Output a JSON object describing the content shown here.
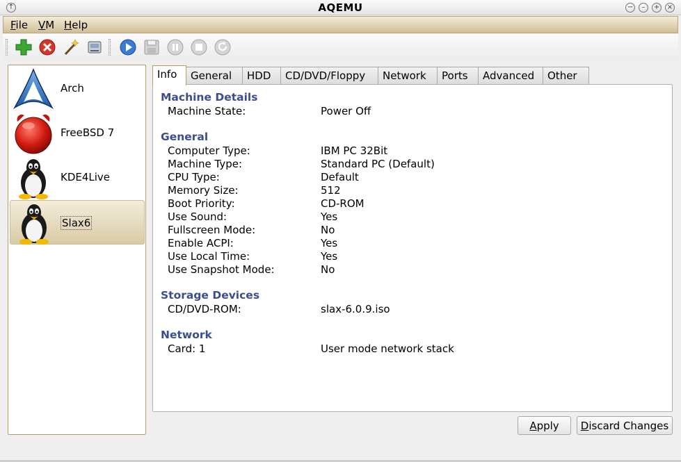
{
  "window": {
    "title": "AQEMU"
  },
  "menu": [
    {
      "mnemonic": "F",
      "rest": "ile"
    },
    {
      "mnemonic": "V",
      "rest": "M"
    },
    {
      "mnemonic": "H",
      "rest": "elp"
    }
  ],
  "toolbar": {
    "icons": [
      "add-vm-icon",
      "delete-vm-icon",
      "wizard-icon",
      "manager-icon",
      "start-icon",
      "save-icon",
      "pause-icon",
      "stop-icon",
      "reset-icon"
    ]
  },
  "vm_list": [
    {
      "name": "Arch",
      "icon": "arch-logo-icon"
    },
    {
      "name": "FreeBSD 7",
      "icon": "freebsd-logo-icon"
    },
    {
      "name": "KDE4Live",
      "icon": "tux-icon"
    },
    {
      "name": "Slax6",
      "icon": "tux-icon",
      "selected": true
    }
  ],
  "tabs": [
    "Info",
    "General",
    "HDD",
    "CD/DVD/Floppy",
    "Network",
    "Ports",
    "Advanced",
    "Other"
  ],
  "active_tab": "Info",
  "info": {
    "machine_details": {
      "title": "Machine Details",
      "rows": [
        {
          "label": "Machine State:",
          "value": "Power Off"
        }
      ]
    },
    "general": {
      "title": "General",
      "rows": [
        {
          "label": "Computer Type:",
          "value": "IBM PC 32Bit"
        },
        {
          "label": "Machine Type:",
          "value": "Standard PC (Default)"
        },
        {
          "label": "CPU Type:",
          "value": "Default"
        },
        {
          "label": "Memory Size:",
          "value": "512"
        },
        {
          "label": "Boot Priority:",
          "value": "CD-ROM"
        },
        {
          "label": "Use Sound:",
          "value": "Yes"
        },
        {
          "label": "Fullscreen Mode:",
          "value": "No"
        },
        {
          "label": "Enable ACPI:",
          "value": "Yes"
        },
        {
          "label": "Use Local Time:",
          "value": "Yes"
        },
        {
          "label": "Use Snapshot Mode:",
          "value": "No"
        }
      ]
    },
    "storage": {
      "title": "Storage Devices",
      "rows": [
        {
          "label": "CD/DVD-ROM:",
          "value": "slax-6.0.9.iso"
        }
      ]
    },
    "network": {
      "title": "Network",
      "rows": [
        {
          "label": "Card: 1",
          "value": "User mode network stack"
        }
      ]
    }
  },
  "buttons": {
    "apply": {
      "mnemonic": "A",
      "rest": "pply"
    },
    "discard": {
      "mnemonic": "D",
      "rest": "iscard Changes"
    }
  },
  "colors": {
    "section_title": "#3b4f8f",
    "menubar": "#d9cba5",
    "selection": "#e3d7b8"
  }
}
